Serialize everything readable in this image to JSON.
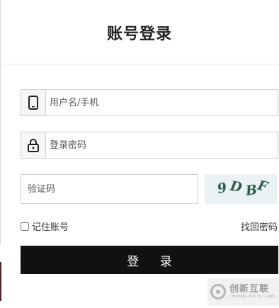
{
  "page": {
    "title": "账号登录"
  },
  "form": {
    "phone_placeholder": "用户名/手机",
    "password_placeholder": "登录密码",
    "captcha_placeholder": "验证码",
    "captcha_text": [
      "9",
      "D",
      "B",
      "F"
    ],
    "remember_label": "记住账号",
    "forgot_label": "找回密码",
    "login_label": "登 录"
  },
  "icons": {
    "phone": "phone-icon",
    "password": "lock-icon"
  },
  "watermark": {
    "main": "创新互联",
    "sub": "CHUANG XIN HU LIAN"
  },
  "colors": {
    "button_bg": "#111111",
    "button_text": "#ffffff",
    "border": "#cfcfcf",
    "captcha_bg": "#eaf2f5",
    "captcha_text": "#2f5a4a"
  }
}
